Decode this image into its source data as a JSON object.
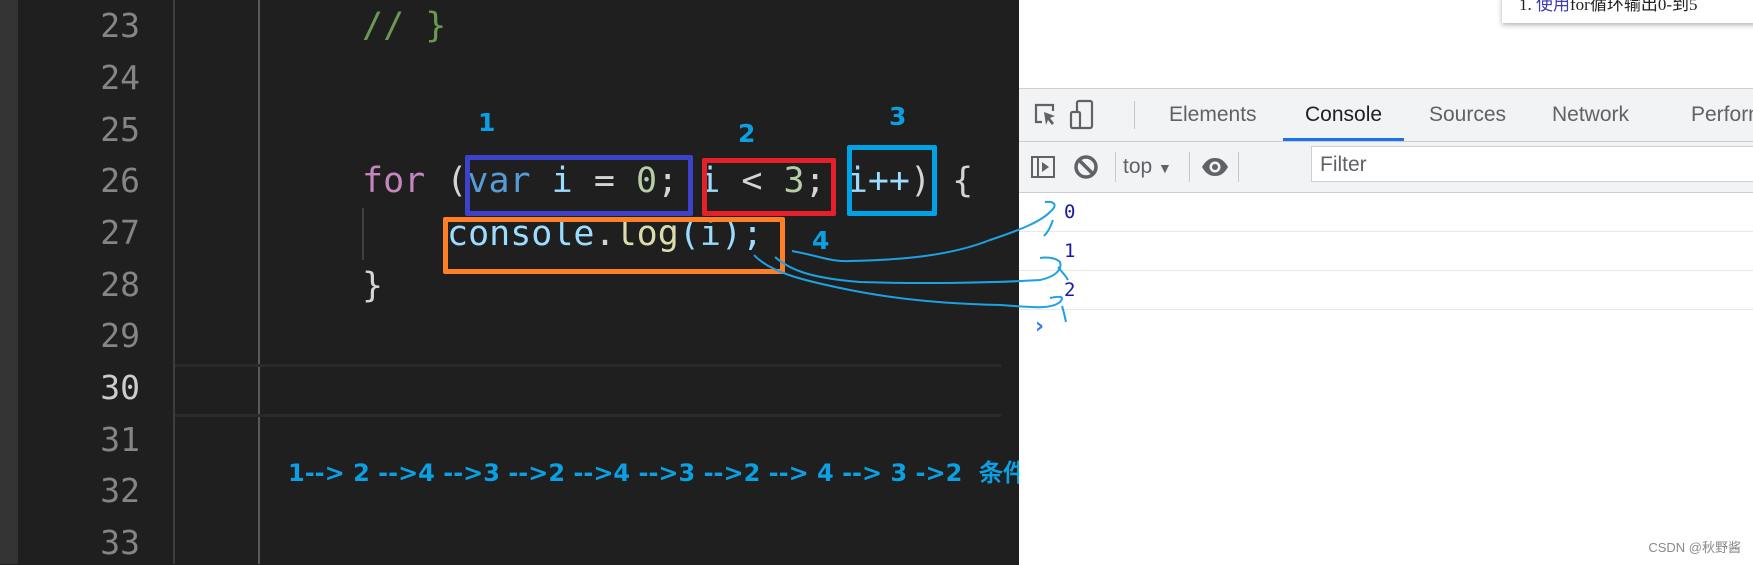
{
  "editor": {
    "line_numbers": [
      "23",
      "24",
      "25",
      "26",
      "27",
      "28",
      "29",
      "30",
      "31",
      "32",
      "33"
    ],
    "active_line": "30",
    "code": {
      "line23_comment": "// }",
      "line26": {
        "kw_for": "for",
        "open_paren": "(",
        "kw_var": "var",
        "init_rest_var": "i",
        "init_eq": "=",
        "init_num": "0",
        "semi": ";",
        "cond_var": "i",
        "cond_op": "<",
        "cond_num": "3",
        "update": "i++",
        "close": ") {"
      },
      "line27": {
        "obj": "console",
        "dot": ".",
        "method": "log",
        "args": "(i);"
      },
      "line28": "}"
    }
  },
  "annotations": {
    "labels": [
      "1",
      "2",
      "3",
      "4"
    ],
    "box_colors": {
      "init": "#3d42c9",
      "condition": "#e6202a",
      "update": "#00a2e6",
      "body": "#ff7f26"
    },
    "flow_text": "1--> 2 -->4 -->3 -->2 -->4 -->3 -->2 --> 4 --> 3 ->2  ",
    "flow_conclusion": "条件不成立 退出循环",
    "accent_color": "#0aa0e3"
  },
  "browser_page": {
    "card_text_prefix": "1. ",
    "card_text_blue": "使用",
    "card_text_rest": "for循环输出0-到5"
  },
  "devtools": {
    "tabs": [
      "Elements",
      "Console",
      "Sources",
      "Network",
      "Perform"
    ],
    "active_tab": "Console",
    "context_selector": "top",
    "filter_placeholder": "Filter",
    "console_output": [
      "0",
      "1",
      "2"
    ],
    "prompt_symbol": "›"
  },
  "watermark": "CSDN @秋野酱"
}
